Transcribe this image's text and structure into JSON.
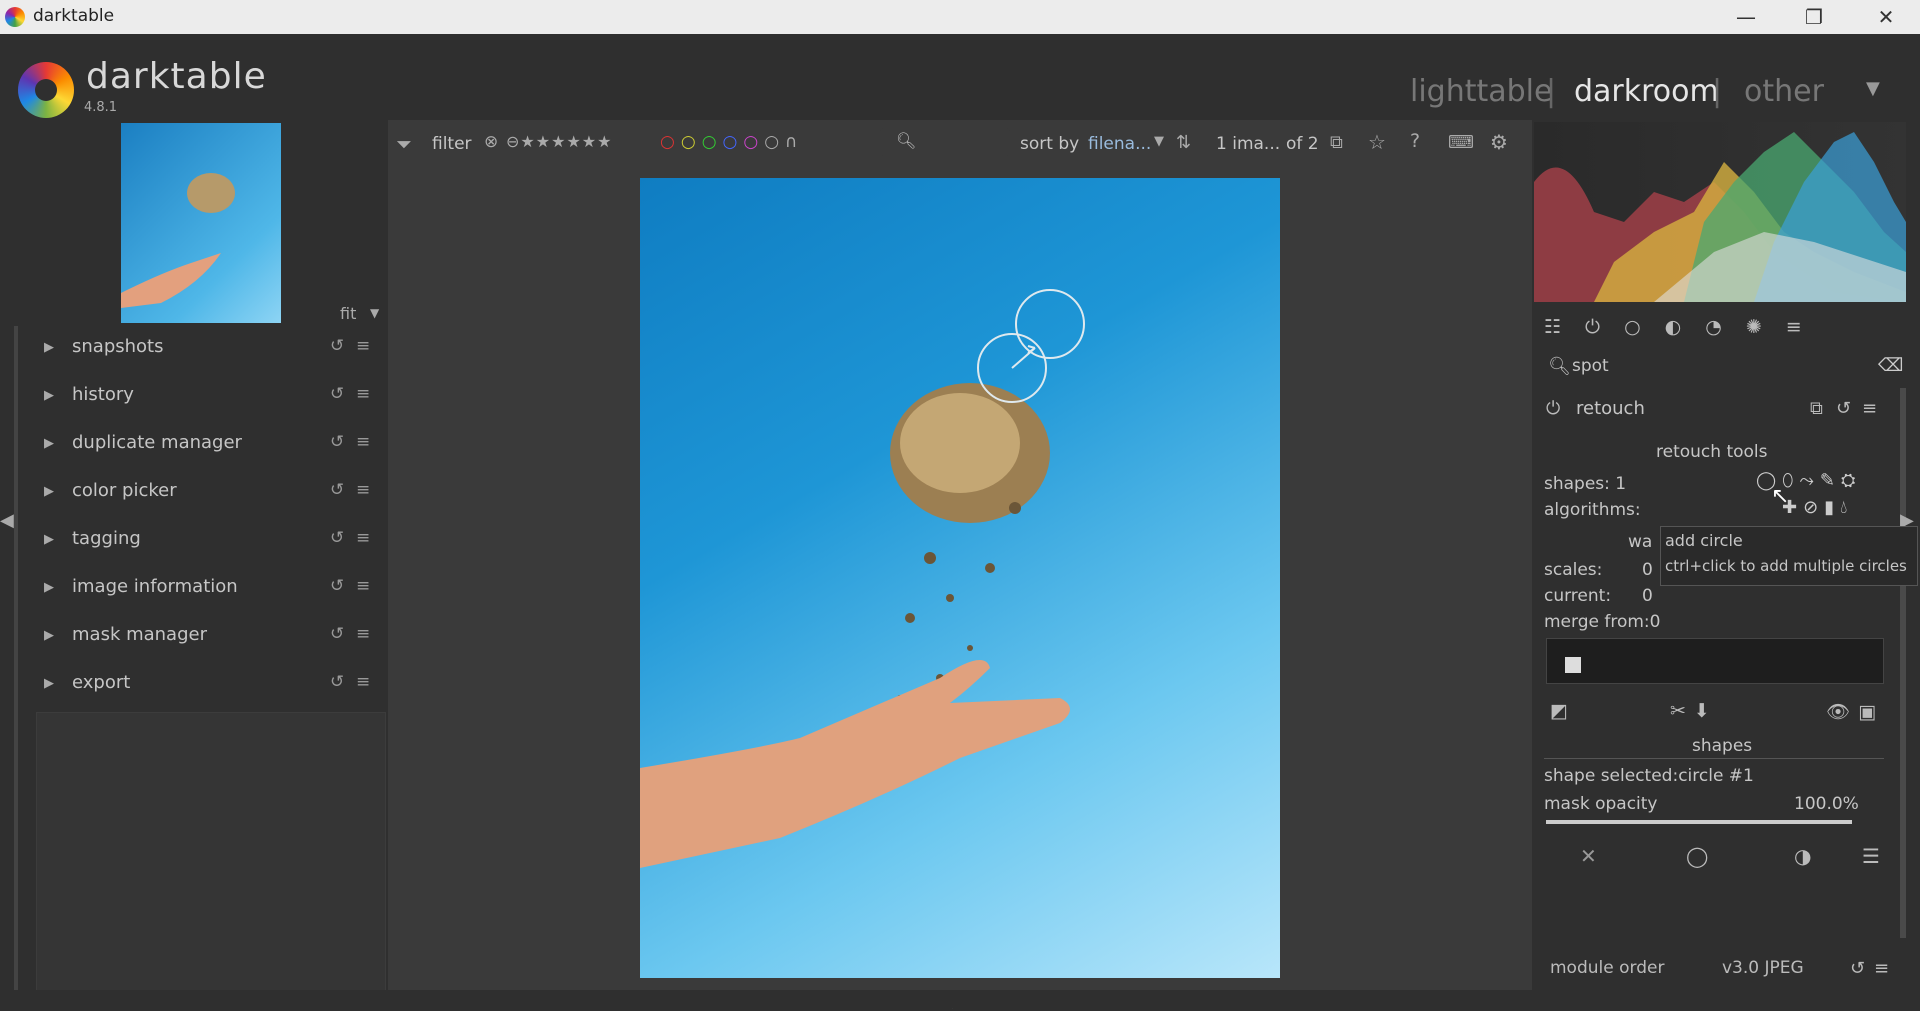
{
  "window": {
    "title": "darktable",
    "minimize": "—",
    "restore": "❐",
    "close": "✕"
  },
  "header": {
    "brand": "darktable",
    "version": "4.8.1",
    "views": [
      "lighttable",
      "darkroom",
      "other"
    ],
    "separator": "|",
    "active_view": "darkroom"
  },
  "left": {
    "zoom_label": "fit",
    "modules": [
      {
        "label": "snapshots"
      },
      {
        "label": "history"
      },
      {
        "label": "duplicate manager"
      },
      {
        "label": "color picker"
      },
      {
        "label": "tagging"
      },
      {
        "label": "image information"
      },
      {
        "label": "mask manager"
      },
      {
        "label": "export"
      }
    ]
  },
  "toolbar": {
    "filter_label": "filter",
    "sort_label": "sort by",
    "sort_value": "filena...",
    "image_count": "1 ima...",
    "image_of": "of 2"
  },
  "right": {
    "search_value": "spot",
    "module_name": "retouch",
    "retouch_tools_title": "retouch tools",
    "shapes_count_label": "shapes: 1",
    "algorithms_label": "algorithms:",
    "wavelets_label_partial": "wa",
    "scales_label": "scales:",
    "scales_value": "0",
    "current_label": "current:",
    "current_value": "0",
    "merge_from_label": "merge from:0",
    "shapes_title": "shapes",
    "shape_selected": "shape selected:circle #1",
    "mask_opacity_label": "mask opacity",
    "mask_opacity_value": "100.0%",
    "mask_opacity_fraction": 1.0,
    "tooltip_title": "add circle",
    "tooltip_hint": "ctrl+click to add multiple circles",
    "module_order_label": "module order",
    "module_order_value": "v3.0 JPEG"
  },
  "colors": {
    "accent_active_view": "#e6e6e6",
    "inactive_view": "#777777",
    "photo_sky": "#1e96d6"
  }
}
